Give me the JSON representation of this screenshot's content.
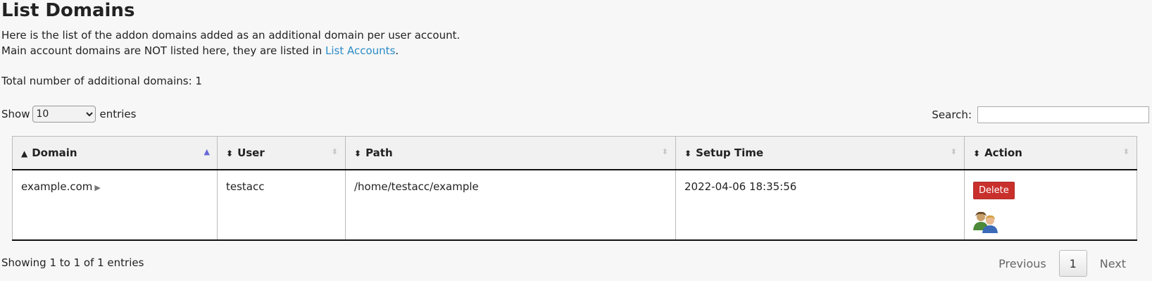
{
  "page": {
    "title": "List Domains",
    "description_line1": "Here is the list of the addon domains added as an additional domain per user account.",
    "description_line2_prefix": "Main account domains are NOT listed here, they are listed in ",
    "description_line2_link": "List Accounts",
    "description_line2_suffix": ".",
    "total_label": "Total number of additional domains: 1"
  },
  "controls": {
    "show_label": "Show",
    "show_value": "10",
    "entries_label": "entries",
    "search_label": "Search:",
    "search_value": ""
  },
  "table": {
    "columns": [
      "Domain",
      "User",
      "Path",
      "Setup Time",
      "Action"
    ],
    "rows": [
      {
        "domain": "example.com",
        "user": "testacc",
        "path": "/home/testacc/example",
        "setup_time": "2022-04-06 18:35:56",
        "action_label": "Delete"
      }
    ]
  },
  "footer": {
    "info": "Showing 1 to 1 of 1 entries",
    "previous": "Previous",
    "page": "1",
    "next": "Next"
  },
  "icons": {
    "sort_up": "sort-up-icon",
    "sort_both": "sort-both-icon",
    "expand": "expand-arrow-icon",
    "users": "users-icon"
  },
  "colors": {
    "link": "#2a8bc7",
    "delete": "#c9302c",
    "active_sort": "#6868d8"
  }
}
